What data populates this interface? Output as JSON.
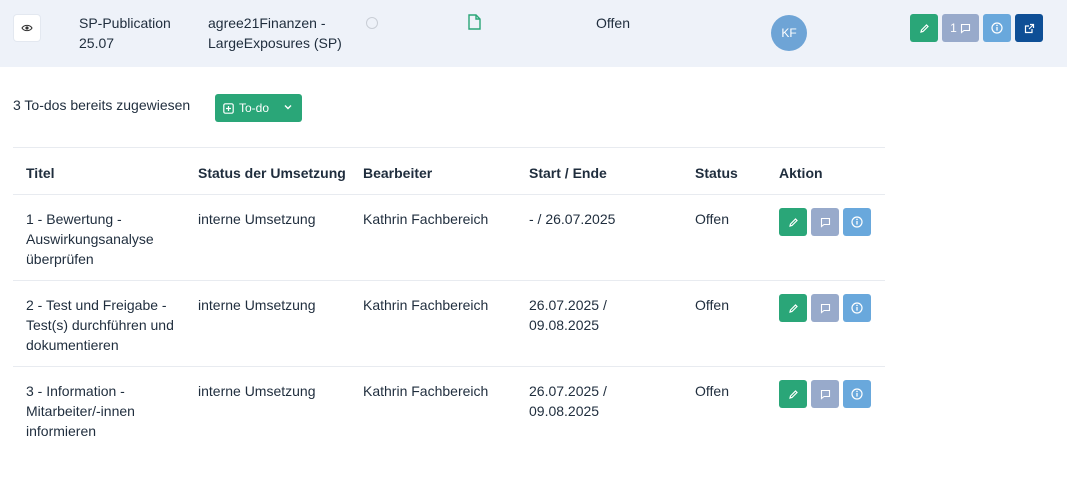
{
  "top_row": {
    "publication": "SP-Publication 25.07",
    "title": "agree21Finanzen - LargeExposures (SP)",
    "status": "Offen",
    "avatar_initials": "KF",
    "comment_count": "1",
    "icons": [
      "eye-icon",
      "status-circle-icon",
      "document-icon",
      "pencil-icon",
      "comment-icon",
      "info-icon",
      "external-link-icon"
    ]
  },
  "summary": {
    "text": "3 To-dos bereits zugewiesen",
    "todo_button_label": "To-do"
  },
  "table": {
    "headers": [
      "Titel",
      "Status der Umsetzung",
      "Bearbeiter",
      "Start / Ende",
      "Status",
      "Aktion"
    ],
    "rows": [
      {
        "title": "1 - Bewertung - Auswirkungsanalyse überprüfen",
        "implementation": "interne Umsetzung",
        "assignee": "Kathrin Fachbereich",
        "dates": "- / 26.07.2025",
        "status": "Offen"
      },
      {
        "title": "2 - Test und Freigabe - Test(s) durchführen und dokumentieren",
        "implementation": "interne Umsetzung",
        "assignee": "Kathrin Fachbereich",
        "dates": "26.07.2025 / 09.08.2025",
        "status": "Offen"
      },
      {
        "title": "3 - Information - Mitarbeiter/-innen informieren",
        "implementation": "interne Umsetzung",
        "assignee": "Kathrin Fachbereich",
        "dates": "26.07.2025 / 09.08.2025",
        "status": "Offen"
      }
    ]
  },
  "colors": {
    "accent_green": "#2aa678",
    "comment_gray_blue": "#98aacb",
    "info_blue": "#69a8dc",
    "external_dark_blue": "#0e4f96",
    "avatar_blue": "#6ea4d6",
    "top_row_bg": "#eef2f9"
  }
}
